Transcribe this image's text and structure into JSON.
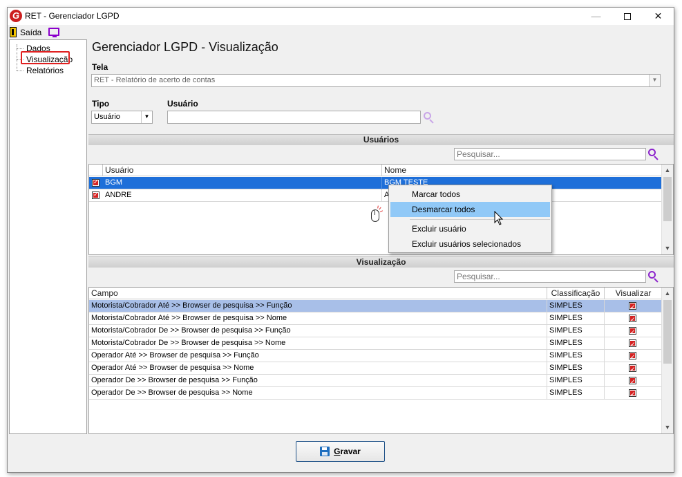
{
  "window": {
    "title": "RET - Gerenciador LGPD",
    "logo_letter": "G",
    "min_glyph": "—",
    "close_glyph": "✕"
  },
  "menu": {
    "exit_label": "Saída"
  },
  "tree": {
    "items": [
      "Dados",
      "Visualização",
      "Relatórios"
    ],
    "selected": "Visualização"
  },
  "main": {
    "title": "Gerenciador LGPD - Visualização",
    "tela_label": "Tela",
    "tela_value": "RET - Relatório de acerto de contas",
    "tipo_label": "Tipo",
    "tipo_value": "Usuário",
    "usuario_label": "Usuário",
    "usuario_value": ""
  },
  "users_section": {
    "title": "Usuários",
    "search_placeholder": "Pesquisar...",
    "columns": [
      "Usuário",
      "Nome"
    ],
    "rows": [
      {
        "checked": true,
        "usuario": "BGM",
        "nome": "BGM TESTE",
        "selected": true
      },
      {
        "checked": true,
        "usuario": "ANDRE",
        "nome": "A",
        "selected": false
      }
    ]
  },
  "context_menu": {
    "items": [
      "Marcar todos",
      "Desmarcar todos",
      "Excluir usuário",
      "Excluir usuários selecionados"
    ],
    "hovered": "Desmarcar todos"
  },
  "visualizacao_section": {
    "title": "Visualização",
    "search_placeholder": "Pesquisar...",
    "columns": [
      "Campo",
      "Classificação",
      "Visualizar"
    ],
    "rows": [
      {
        "campo": "Motorista/Cobrador Até >> Browser de pesquisa >> Função",
        "classificacao": "SIMPLES",
        "visualizar": true
      },
      {
        "campo": "Motorista/Cobrador Até >> Browser de pesquisa >> Nome",
        "classificacao": "SIMPLES",
        "visualizar": true
      },
      {
        "campo": "Motorista/Cobrador De >> Browser de pesquisa >> Função",
        "classificacao": "SIMPLES",
        "visualizar": true
      },
      {
        "campo": "Motorista/Cobrador De >> Browser de pesquisa >> Nome",
        "classificacao": "SIMPLES",
        "visualizar": true
      },
      {
        "campo": "Operador Até >> Browser de pesquisa >> Função",
        "classificacao": "SIMPLES",
        "visualizar": true
      },
      {
        "campo": "Operador Até >> Browser de pesquisa >> Nome",
        "classificacao": "SIMPLES",
        "visualizar": true
      },
      {
        "campo": "Operador De >> Browser de pesquisa >> Função",
        "classificacao": "SIMPLES",
        "visualizar": true
      },
      {
        "campo": "Operador De >> Browser de pesquisa >> Nome",
        "classificacao": "SIMPLES",
        "visualizar": true
      }
    ]
  },
  "footer": {
    "save_label": "Gravar"
  },
  "colors": {
    "selected_row": "#1e6fd9",
    "highlight_row": "#a8bfe8",
    "menu_hover": "#91c9f7",
    "accent_purple": "#8b22cc",
    "tree_highlight_border": "#e02020"
  }
}
